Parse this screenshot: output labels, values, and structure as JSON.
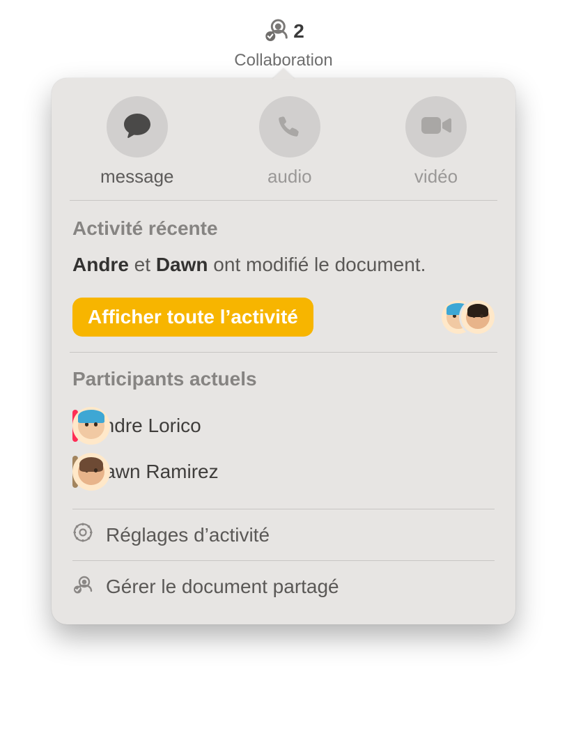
{
  "toolbar": {
    "collab_count": "2",
    "collab_label": "Collaboration"
  },
  "comm": {
    "message": "message",
    "audio": "audio",
    "video": "vidéo",
    "active": "message"
  },
  "activity": {
    "section_title": "Activité récente",
    "person1": "Andre",
    "connector1": " et ",
    "person2": "Dawn",
    "suffix": " ont modifié le document.",
    "show_all_label": "Afficher toute l’activité"
  },
  "participants": {
    "section_title": "Participants actuels",
    "list": [
      {
        "name": "Andre Lorico",
        "presence_color": "pink",
        "avatar_variant": "hat"
      },
      {
        "name": "Dawn Ramirez",
        "presence_color": "brown",
        "avatar_variant": "brown"
      }
    ]
  },
  "footer": {
    "settings_label": "Réglages d’activité",
    "manage_label": "Gérer le document partagé"
  },
  "icons": {
    "collaboration": "collaboration-icon",
    "message": "message-icon",
    "audio": "phone-icon",
    "video": "video-icon",
    "settings": "gear-icon",
    "manage": "share-icon"
  }
}
